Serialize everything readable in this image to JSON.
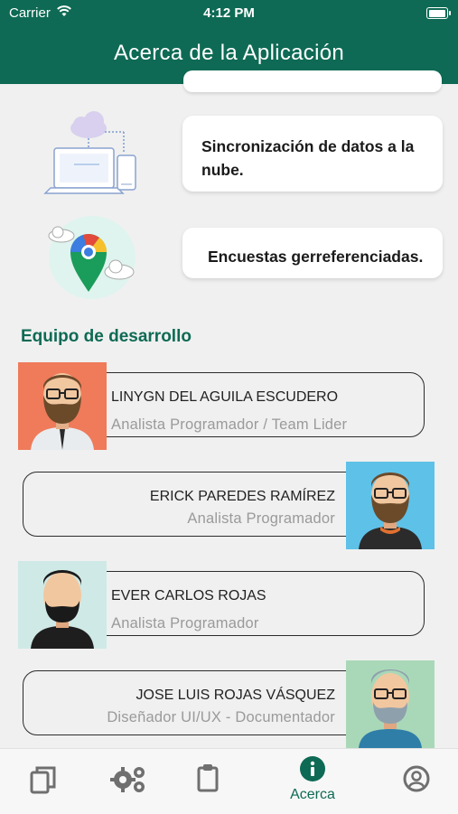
{
  "status_bar": {
    "carrier": "Carrier",
    "time": "4:12 PM"
  },
  "header": {
    "title": "Acerca de la Aplicación"
  },
  "features": [
    {
      "text": "Sincronización de datos a la nube.",
      "icon": "cloud-sync-laptop-icon"
    },
    {
      "text": "Encuestas gerreferenciadas.",
      "icon": "map-pin-icon"
    }
  ],
  "team": {
    "title": "Equipo de desarrollo",
    "members": [
      {
        "name": "LINYGN DEL AGUILA ESCUDERO",
        "role": "Analista Programador / Team Lider",
        "avatar_bg": "#ef7b5a"
      },
      {
        "name": "ERICK PAREDES RAMÍREZ",
        "role": "Analista Programador",
        "avatar_bg": "#5ec1e8"
      },
      {
        "name": "EVER CARLOS ROJAS",
        "role": "Analista Programador",
        "avatar_bg": "#cfe9e6"
      },
      {
        "name": "JOSE LUIS ROJAS VÁSQUEZ",
        "role": "Diseñador UI/UX - Documentador",
        "avatar_bg": "#a9d8b8"
      }
    ]
  },
  "tabbar": {
    "items": [
      {
        "icon": "copy-icon"
      },
      {
        "icon": "gears-icon"
      },
      {
        "icon": "clipboard-icon"
      },
      {
        "icon": "info-icon",
        "label": "Acerca",
        "active": true
      },
      {
        "icon": "user-icon"
      }
    ]
  },
  "colors": {
    "primary": "#0e6a54",
    "background": "#f0f0f0",
    "muted_text": "#9a9a9a"
  }
}
